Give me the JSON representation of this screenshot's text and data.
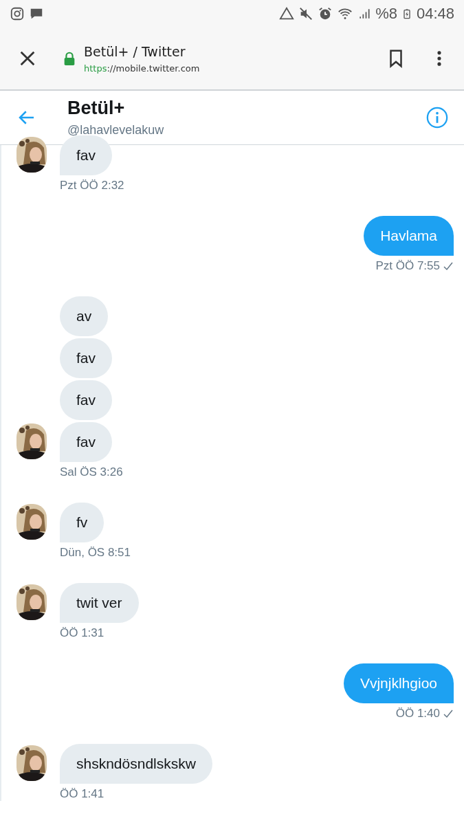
{
  "status_bar": {
    "battery": "%8",
    "time": "04:48"
  },
  "browser": {
    "title": "Betül+ / Twitter",
    "url_scheme": "https",
    "url_rest": "://mobile.twitter.com"
  },
  "header": {
    "name": "Betül+",
    "handle": "@lahavlevelakuw"
  },
  "groups": [
    {
      "kind": "received",
      "bubbles": [
        "fav"
      ],
      "time": "Pzt ÖÖ 2:32"
    },
    {
      "kind": "sent",
      "bubbles": [
        "Havlama"
      ],
      "time": "Pzt ÖÖ 7:55",
      "read": true
    },
    {
      "kind": "received",
      "bubbles": [
        "av",
        "fav",
        "fav",
        "fav"
      ],
      "time": "Sal ÖS 3:26"
    },
    {
      "kind": "received",
      "bubbles": [
        "fv"
      ],
      "time": "Dün, ÖS 8:51"
    },
    {
      "kind": "received",
      "bubbles": [
        "twit ver"
      ],
      "time": "ÖÖ 1:31"
    },
    {
      "kind": "sent",
      "bubbles": [
        "Vvjnjklhgioo"
      ],
      "time": "ÖÖ 1:40",
      "read": true
    },
    {
      "kind": "received",
      "bubbles": [
        "shskndösndlskskw"
      ],
      "time": "ÖÖ 1:41"
    }
  ]
}
